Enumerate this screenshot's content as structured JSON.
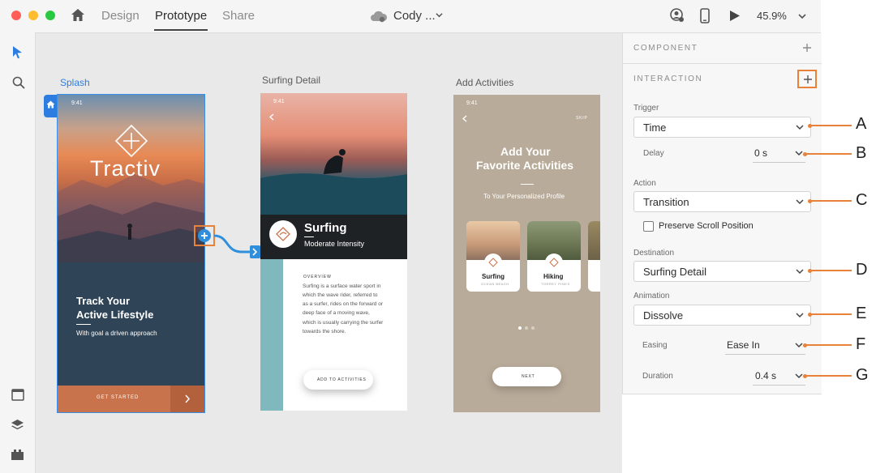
{
  "titlebar": {
    "tabs": [
      {
        "label": "Design",
        "active": false
      },
      {
        "label": "Prototype",
        "active": true
      },
      {
        "label": "Share",
        "active": false
      }
    ],
    "doc_title": "Cody ...",
    "zoom": "45.9%",
    "icons": [
      "home-icon",
      "cloud-icon",
      "user-icon",
      "phone-icon",
      "play-icon"
    ]
  },
  "toolbar": {
    "icons": [
      "select-arrow-icon",
      "zoom-icon",
      "artboard-icon",
      "layers-icon",
      "plugins-icon"
    ]
  },
  "canvas": {
    "artboards": [
      {
        "title": "Splash"
      },
      {
        "title": "Surfing Detail"
      },
      {
        "title": "Add Activities"
      }
    ],
    "splash": {
      "time": "9:41",
      "brand": "Tractiv",
      "headline_1": "Track Your",
      "headline_2": "Active Lifestyle",
      "subtitle": "With goal a driven approach",
      "cta": "GET STARTED"
    },
    "surfing": {
      "time": "9:41",
      "title": "Surfing",
      "subtitle": "Moderate Intensity",
      "overview_title": "OVERVIEW",
      "overview_lines": [
        "Surfing is a surface water sport in",
        "which the wave rider, referred to",
        "as a surfer, rides on the forward or",
        "deep face of a moving wave,",
        "which is usually carrying the surfer",
        "towards the shore."
      ],
      "button": "ADD TO ACTIVITIES"
    },
    "activities": {
      "time": "9:41",
      "skip": "SKIP",
      "title_1": "Add Your",
      "title_2": "Favorite Activities",
      "subtitle": "To Your Personalized Profile",
      "card_1_title": "Surfing",
      "card_1_sub": "OCEAN BEACH",
      "card_2_title": "Hiking",
      "card_2_sub": "TORREY PINES",
      "button": "NEXT"
    }
  },
  "panel": {
    "component_title": "COMPONENT",
    "interaction_title": "INTERACTION",
    "trigger_label": "Trigger",
    "trigger_value": "Time",
    "delay_label": "Delay",
    "delay_value": "0 s",
    "action_label": "Action",
    "action_value": "Transition",
    "preserve_label": "Preserve Scroll Position",
    "preserve_checked": false,
    "destination_label": "Destination",
    "destination_value": "Surfing Detail",
    "animation_label": "Animation",
    "animation_value": "Dissolve",
    "easing_label": "Easing",
    "easing_value": "Ease In",
    "duration_label": "Duration",
    "duration_value": "0.4 s"
  },
  "callouts": [
    "A",
    "B",
    "C",
    "D",
    "E",
    "F",
    "G"
  ],
  "colors": {
    "accent_blue": "#2d7de0",
    "callout_orange": "#e8823a",
    "wire_blue": "#2f8fdc"
  }
}
